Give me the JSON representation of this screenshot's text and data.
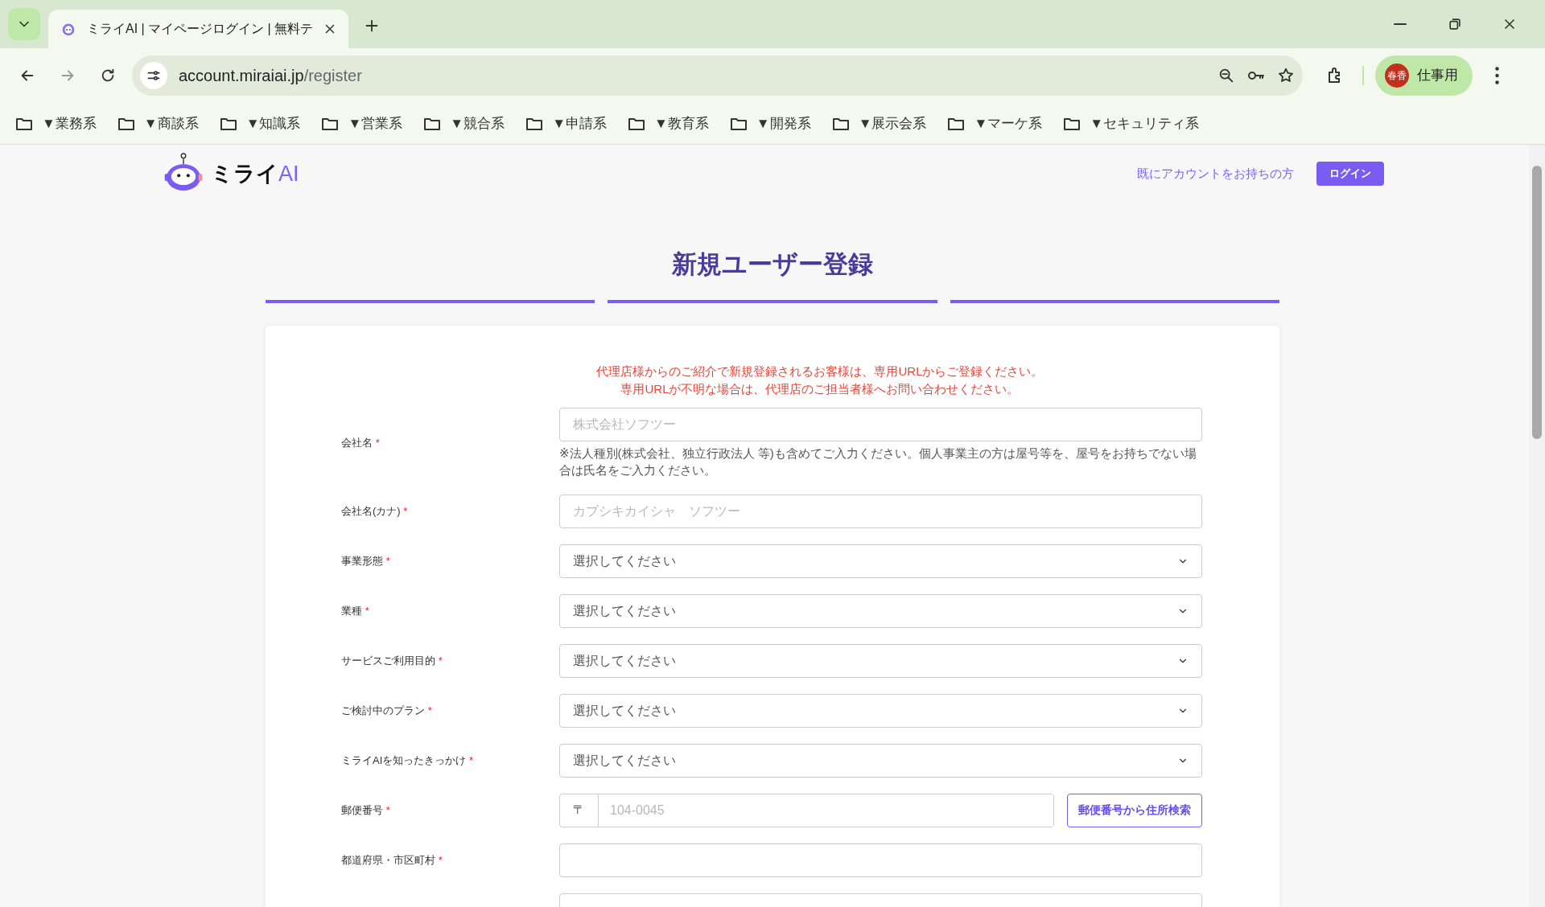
{
  "browser": {
    "tab_title": "ミライAI | マイページログイン | 無料テ",
    "url_host": "account.miraiai.jp",
    "url_path": "/register",
    "profile_avatar": "春香",
    "profile_name": "仕事用",
    "bookmarks": [
      "▼業務系",
      "▼商談系",
      "▼知識系",
      "▼営業系",
      "▼競合系",
      "▼申請系",
      "▼教育系",
      "▼開発系",
      "▼展示会系",
      "▼マーケ系",
      "▼セキュリティ系"
    ]
  },
  "header": {
    "logo_text": "ミライ",
    "logo_accent": "AI",
    "account_prompt": "既にアカウントをお持ちの方",
    "login_button": "ログイン"
  },
  "page_title": "新規ユーザー登録",
  "notice": [
    "代理店様からのご紹介で新規登録されるお客様は、専用URLからご登録ください。",
    "専用URLが不明な場合は、代理店のご担当者様へお問い合わせください。"
  ],
  "fields": [
    {
      "kind": "text",
      "label": "会社名",
      "required_mark": "*",
      "placeholder": "株式会社ソフツー",
      "help": "※法人種別(株式会社、独立行政法人 等)も含めてご入力ください。個人事業主の方は屋号等を、屋号をお持ちでない場合は氏名をご入力ください。"
    },
    {
      "kind": "text",
      "label": "会社名(カナ)",
      "required_mark": "*",
      "placeholder": "カブシキカイシャ　ソフツー"
    },
    {
      "kind": "select",
      "label": "事業形態",
      "required_mark": "*",
      "value": "選択してください"
    },
    {
      "kind": "select",
      "label": "業種",
      "required_mark": "*",
      "value": "選択してください"
    },
    {
      "kind": "select",
      "label": "サービスご利用目的",
      "required_mark": "*",
      "value": "選択してください"
    },
    {
      "kind": "select",
      "label": "ご検討中のプラン",
      "required_mark": "*",
      "value": "選択してください"
    },
    {
      "kind": "select",
      "label": "ミライAIを知ったきっかけ",
      "required_mark": "*",
      "value": "選択してください"
    },
    {
      "kind": "postal",
      "label": "郵便番号",
      "required_mark": "*",
      "prefix": "〒",
      "placeholder": "104-0045",
      "button": "郵便番号から住所検索"
    },
    {
      "kind": "text",
      "label": "都道府県・市区町村",
      "required_mark": "*"
    },
    {
      "kind": "text"
    }
  ]
}
